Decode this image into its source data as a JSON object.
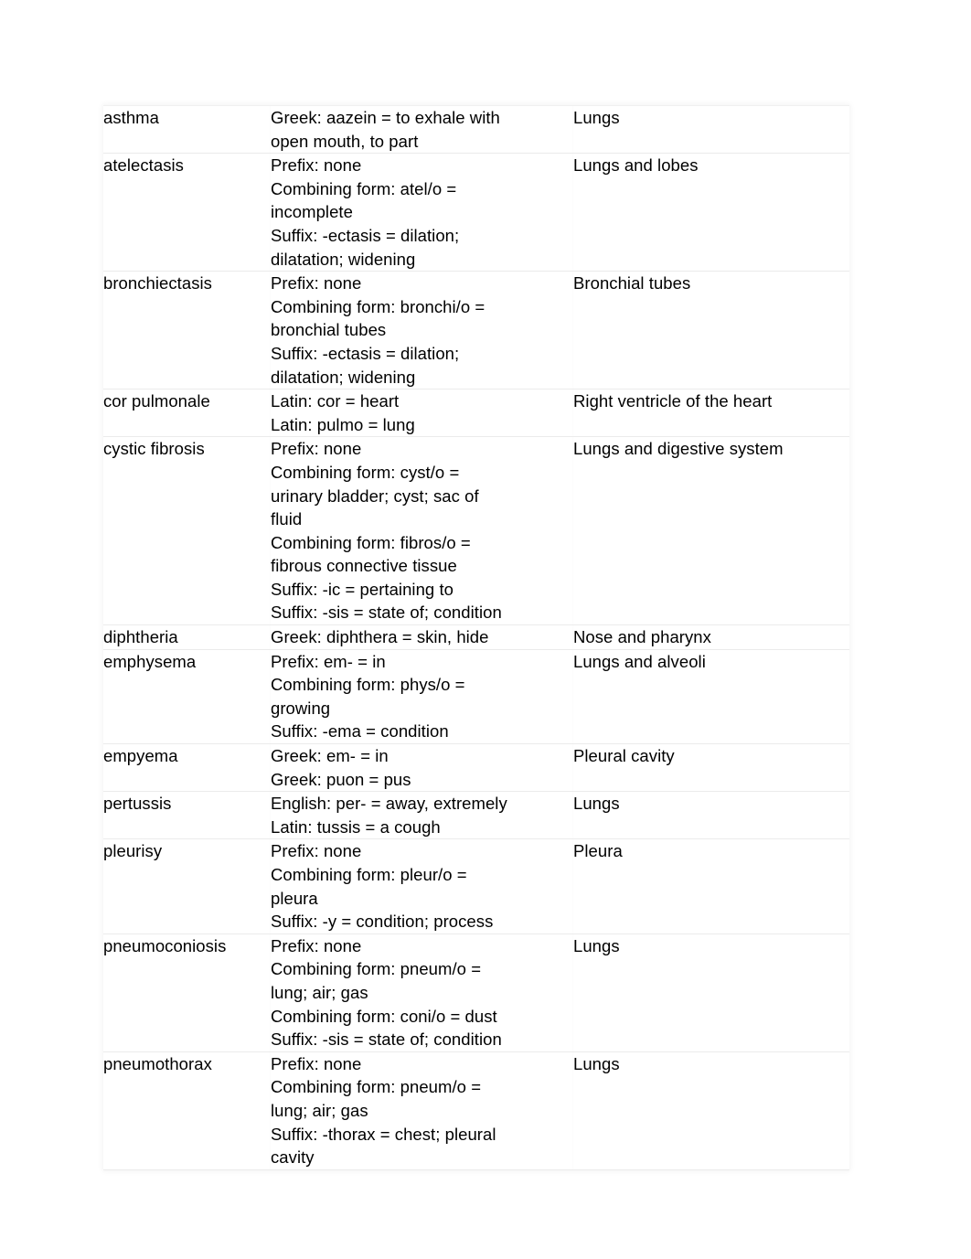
{
  "document": {
    "type": "medical-terminology-table",
    "background_color": "#ffffff",
    "text_color": "#000000",
    "row_separator_color": "#ebebeb"
  },
  "table": {
    "columns": [
      "term",
      "word_origin",
      "body_part"
    ],
    "rows": [
      {
        "term": [
          "asthma"
        ],
        "origin": [
          "Greek: aazein = to exhale with",
          "open mouth, to part"
        ],
        "part": [
          "Lungs"
        ]
      },
      {
        "term": [
          "atelectasis"
        ],
        "origin": [
          "Prefix: none",
          "Combining form: atel/o =",
          "incomplete",
          "Suffix: -ectasis = dilation;",
          "dilatation; widening"
        ],
        "part": [
          "Lungs and lobes"
        ]
      },
      {
        "term": [
          "bronchiectasis"
        ],
        "origin": [
          "Prefix: none",
          "Combining form: bronchi/o =",
          "bronchial tubes",
          "Suffix: -ectasis = dilation;",
          "dilatation; widening"
        ],
        "part": [
          "Bronchial tubes"
        ]
      },
      {
        "term": [
          "cor pulmonale"
        ],
        "origin": [
          "Latin: cor = heart",
          "Latin: pulmo = lung"
        ],
        "part": [
          "Right ventricle of the heart"
        ]
      },
      {
        "term": [
          "cystic fibrosis"
        ],
        "origin": [
          "Prefix: none",
          "Combining form: cyst/o =",
          "urinary bladder; cyst; sac of",
          "fluid",
          "Combining form: fibros/o =",
          "fibrous connective tissue",
          "Suffix: -ic = pertaining to",
          "Suffix: -sis = state of; condition"
        ],
        "part": [
          "Lungs and digestive system"
        ]
      },
      {
        "term": [
          "diphtheria"
        ],
        "origin": [
          "Greek: diphthera = skin, hide"
        ],
        "part": [
          "Nose and pharynx"
        ]
      },
      {
        "term": [
          "emphysema"
        ],
        "origin": [
          "Prefix: em- = in",
          "Combining form: phys/o =",
          "growing",
          "Suffix: -ema = condition"
        ],
        "part": [
          "Lungs and alveoli"
        ]
      },
      {
        "term": [
          "empyema"
        ],
        "origin": [
          "Greek: em- = in",
          "Greek: puon = pus"
        ],
        "part": [
          "Pleural cavity"
        ]
      },
      {
        "term": [
          "pertussis"
        ],
        "origin": [
          "English: per- = away, extremely",
          "Latin: tussis = a cough"
        ],
        "part": [
          "Lungs"
        ]
      },
      {
        "term": [
          "pleurisy"
        ],
        "origin": [
          "Prefix: none",
          "Combining form: pleur/o =",
          "pleura",
          "Suffix: -y = condition; process"
        ],
        "part": [
          "Pleura"
        ]
      },
      {
        "term": [
          "pneumoconiosis"
        ],
        "origin": [
          "Prefix: none",
          "Combining form: pneum/o =",
          "lung; air; gas",
          "Combining form: coni/o = dust",
          "Suffix: -sis = state of; condition"
        ],
        "part": [
          "Lungs"
        ]
      },
      {
        "term": [
          "pneumothorax"
        ],
        "origin": [
          "Prefix: none",
          "Combining form: pneum/o =",
          "lung; air; gas",
          "Suffix: -thorax = chest; pleural",
          "cavity"
        ],
        "part": [
          "Lungs"
        ]
      }
    ]
  }
}
